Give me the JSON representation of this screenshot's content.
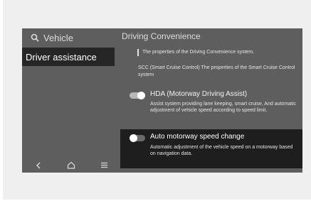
{
  "sidebar": {
    "search_label": "Vehicle",
    "selected_item": "Driver assistance",
    "nav": {
      "back_icon": "back-icon",
      "home_icon": "home-icon",
      "menu_icon": "menu-icon"
    }
  },
  "main": {
    "title": "Driving Convenience",
    "description": "The properties of the Driving Convenience system.",
    "scc_text": "SCC (Smart Cruise Control) The properties of the Smart Cruise Control system",
    "hda": {
      "title": "HDA (Motorway Driving Assist)",
      "description": "Assist system providing lane keeping, smart cruise, And automatic adjustment of vehicle speed according to speed limit.",
      "enabled": true
    },
    "ams": {
      "title": "Auto motorway speed change",
      "description": "Automatic adjustment of the vehicle speed on a motorway based on navigation data.",
      "enabled": false
    }
  },
  "colors": {
    "screen_bg": "#5e5e5e",
    "selected_bg": "#262626",
    "card_bg": "#1e1e1e",
    "text": "#e6e6e6"
  }
}
